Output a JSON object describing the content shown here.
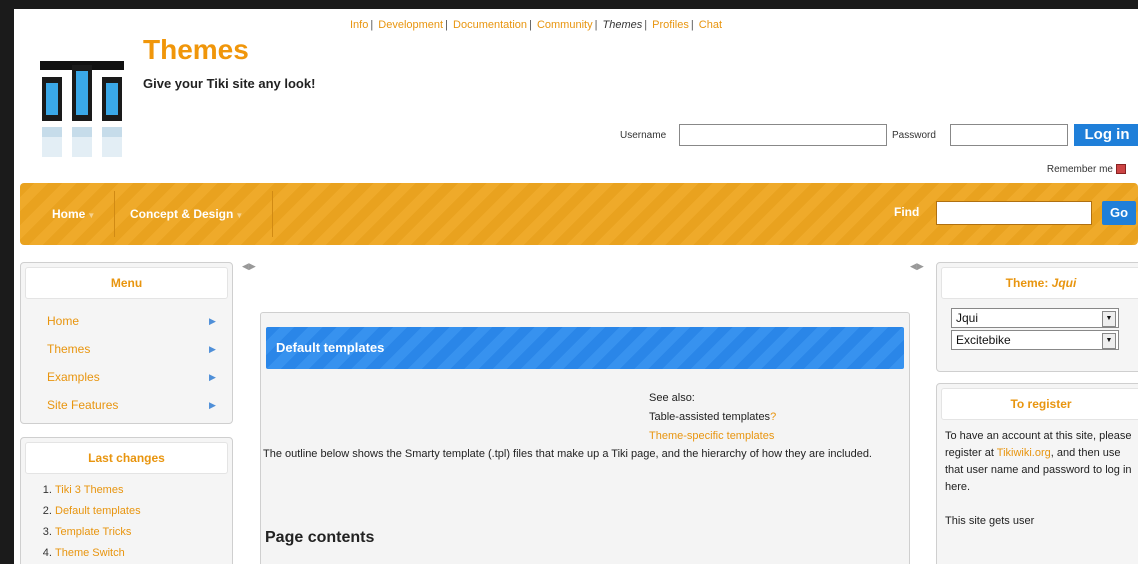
{
  "top_links": [
    "Info",
    "Development",
    "Documentation",
    "Community",
    "Themes",
    "Profiles",
    "Chat"
  ],
  "current_top_link": "Themes",
  "header": {
    "title": "Themes",
    "slogan": "Give your Tiki site any look!"
  },
  "login": {
    "username_label": "Username",
    "password_label": "Password",
    "login_button": "Log in",
    "remember_me": "Remember me"
  },
  "nav": {
    "items": [
      "Home",
      "Concept & Design"
    ],
    "find_label": "Find",
    "go_button": "Go"
  },
  "menu_module": {
    "title": "Menu",
    "items": [
      "Home",
      "Themes",
      "Examples",
      "Site Features"
    ]
  },
  "last_changes": {
    "title": "Last changes",
    "items": [
      "Tiki 3 Themes",
      "Default templates",
      "Template Tricks",
      "Theme Switch"
    ]
  },
  "content": {
    "heading": "Default templates",
    "see_also_label": "See also:",
    "see_also_1": "Table-assisted templates",
    "see_also_1_suffix": "?",
    "see_also_2": "Theme-specific templates",
    "intro": "The outline below shows the Smarty template (.tpl) files that make up a Tiki page, and the hierarchy of how they are included.",
    "section_heading": "Page contents"
  },
  "theme_module": {
    "title_prefix": "Theme: ",
    "title_value": "Jqui",
    "theme_value": "Jqui",
    "option_value": "Excitebike"
  },
  "register_module": {
    "title": "To register",
    "text_1": "To have an account at this site, please register at",
    "link": "Tikiwiki.org",
    "text_2": ", and then use that user name and password to log in here.",
    "text_3": "This site gets user"
  },
  "colors": {
    "accent_orange": "#e8950f",
    "button_blue": "#1f7fd9",
    "nav_orange": "#e9a21f"
  }
}
